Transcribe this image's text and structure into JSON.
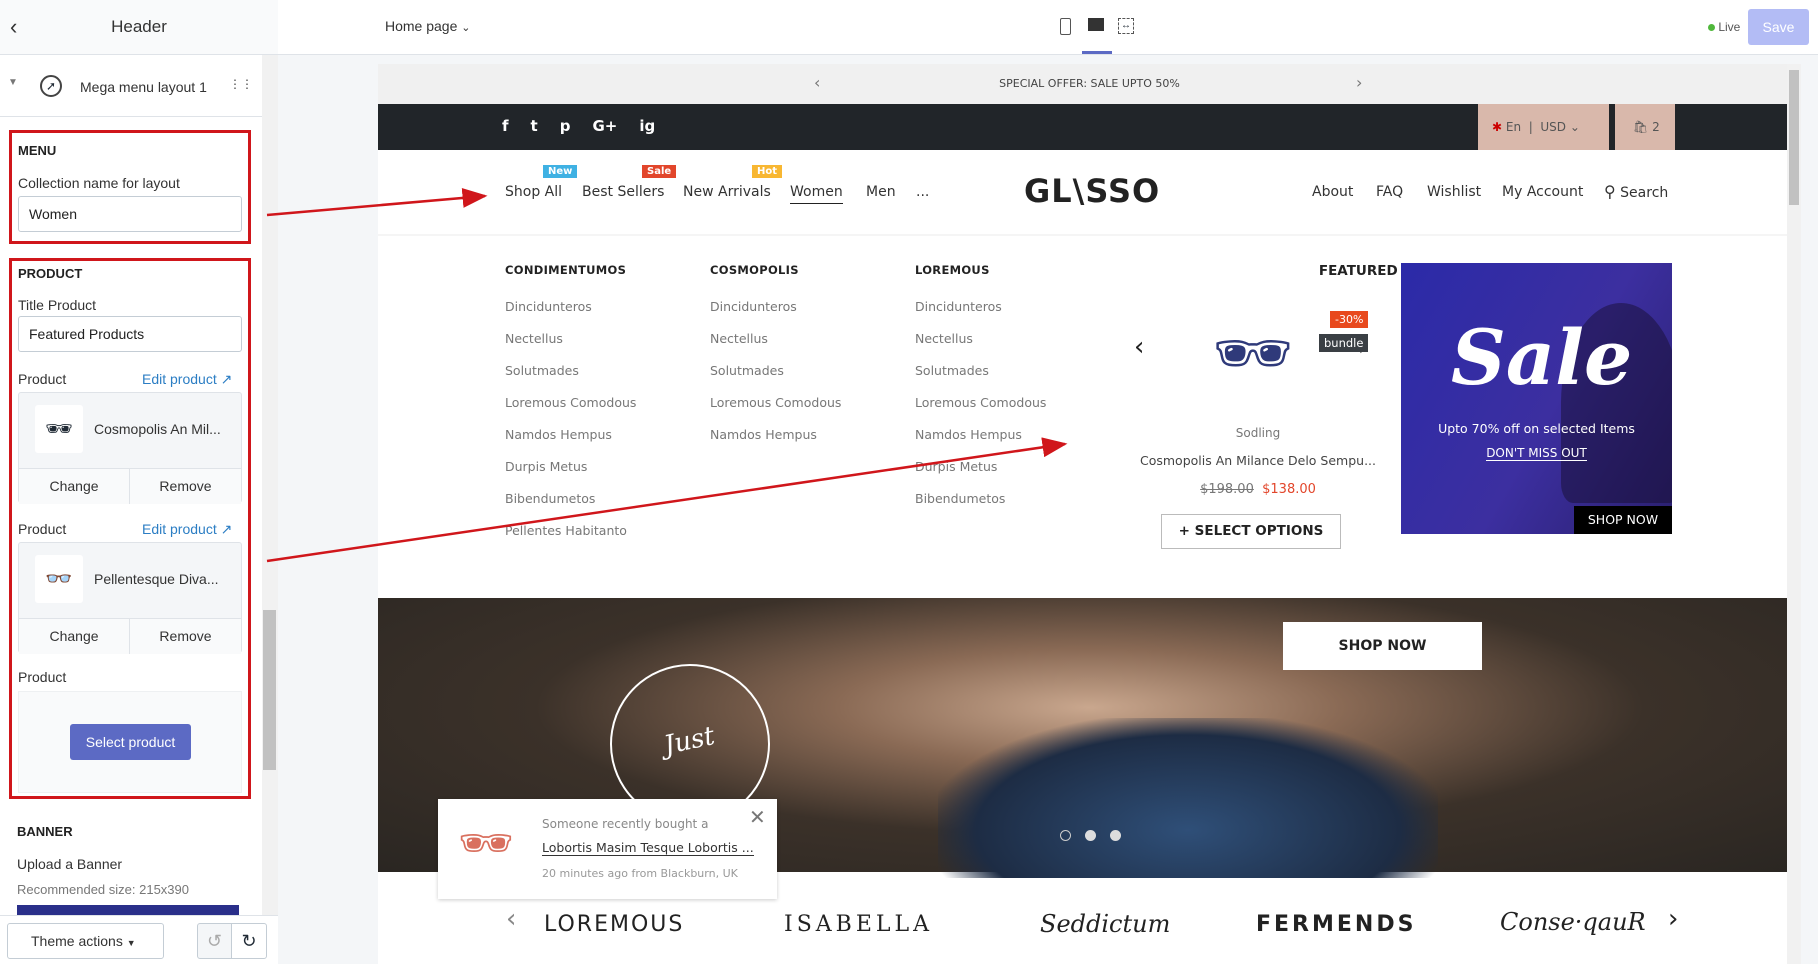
{
  "sidebar": {
    "title": "Header",
    "section_item": "Mega menu layout 1",
    "menu": {
      "heading": "MENU",
      "collection_label": "Collection name for layout",
      "collection_value": "Women"
    },
    "product": {
      "heading": "PRODUCT",
      "title_label": "Title Product",
      "title_value": "Featured Products",
      "items": [
        {
          "label": "Product",
          "edit": "Edit product",
          "name": "Cosmopolis An Mil...",
          "change": "Change",
          "remove": "Remove"
        },
        {
          "label": "Product",
          "edit": "Edit product",
          "name": "Pellentesque Diva...",
          "change": "Change",
          "remove": "Remove"
        }
      ],
      "empty_label": "Product",
      "select_button": "Select product"
    },
    "banner": {
      "heading": "BANNER",
      "upload_label": "Upload a Banner",
      "recommended": "Recommended size: 215x390"
    },
    "footer": {
      "theme_actions": "Theme actions"
    }
  },
  "topbar": {
    "page_select": "Home page",
    "live": "Live",
    "save": "Save",
    "colors": {
      "live": "#50b83c",
      "save_bg": "#b3bcf5",
      "accent": "#5c6ac4"
    }
  },
  "store": {
    "announcement": "SPECIAL OFFER: SALE UPTO 50%",
    "social": [
      "f",
      "t",
      "p",
      "G+",
      "ig"
    ],
    "language": "En",
    "currency": "USD",
    "cart_count": "2",
    "logo": "GL\\SSO",
    "nav": [
      {
        "label": "Shop All",
        "badge": "New",
        "badge_color": "#3fb1e3"
      },
      {
        "label": "Best Sellers",
        "badge": "Sale",
        "badge_color": "#e2462b"
      },
      {
        "label": "New Arrivals",
        "badge": "Hot",
        "badge_color": "#f8b732"
      },
      {
        "label": "Women",
        "active": true
      },
      {
        "label": "Men"
      },
      {
        "label": "..."
      }
    ],
    "right_nav": [
      "About",
      "FAQ",
      "Wishlist",
      "My Account",
      "Search"
    ],
    "mega": {
      "columns": [
        {
          "heading": "CONDIMENTUMOS",
          "items": [
            "Dincidunteros",
            "Nectellus",
            "Solutmades",
            "Loremous Comodous",
            "Namdos Hempus",
            "Durpis Metus",
            "Bibendumetos",
            "Pellentes Habitanto"
          ]
        },
        {
          "heading": "COSMOPOLIS",
          "items": [
            "Dincidunteros",
            "Nectellus",
            "Solutmades",
            "Loremous Comodous",
            "Namdos Hempus"
          ]
        },
        {
          "heading": "LOREMOUS",
          "items": [
            "Dincidunteros",
            "Nectellus",
            "Solutmades",
            "Loremous Comodous",
            "Namdos Hempus",
            "Durpis Metus",
            "Bibendumetos"
          ]
        }
      ],
      "featured": {
        "heading": "FEATURED PRODUCTS",
        "discount": "-30%",
        "tag": "bundle",
        "vendor": "Sodling",
        "name": "Cosmopolis An Milance Delo Sempu...",
        "old_price": "$198.00",
        "price": "$138.00",
        "button": "SELECT OPTIONS"
      },
      "banner": {
        "title": "Sale",
        "subtitle": "Upto 70% off on selected Items",
        "link": "DON'T MISS OUT",
        "button": "SHOP NOW"
      }
    },
    "hero": {
      "button": "SHOP NOW",
      "stamp": "Just Arrived!",
      "slides": 3,
      "active_slide": 1
    },
    "notification": {
      "line1": "Someone recently bought a",
      "product": "Lobortis Masim Tesque Lobortis ...",
      "meta": "20 minutes ago from Blackburn, UK"
    },
    "brands": [
      "LOREMOUS",
      "ISABELLA",
      "Seddictum",
      "FERMENDS",
      "Conse·qauR"
    ]
  }
}
